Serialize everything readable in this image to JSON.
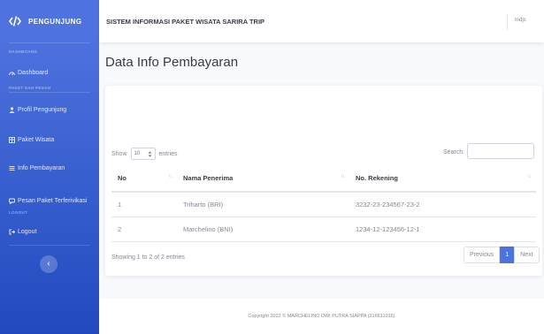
{
  "sidebar": {
    "brand": "PENGUNJUNG",
    "headings": {
      "dashboard": "DASHBOARD",
      "paket": "PAKET DAN PESAN",
      "logout": "LOGOUT"
    },
    "items": [
      {
        "label": "Dashboard",
        "icon": "gauge-icon"
      },
      {
        "label": "Profil Pengunjung",
        "icon": "user-icon"
      },
      {
        "label": "Paket Wisata",
        "icon": "table-icon"
      },
      {
        "label": "Info Pembayaran",
        "icon": "list-icon"
      },
      {
        "label": "Pesan Paket Terferivikasi",
        "icon": "chat-icon"
      },
      {
        "label": "Logout",
        "icon": "logout-icon"
      }
    ],
    "toggle_glyph": "‹"
  },
  "topbar": {
    "title": "SISTEM INFORMASI PAKET WISATA SARIRA TRIP",
    "user": "mdjs"
  },
  "page_title": "Data Info Pembayaran",
  "table_controls": {
    "show": "Show",
    "entries_value": "10",
    "entries": "entries",
    "search_label": "Search:",
    "search_value": ""
  },
  "table": {
    "headers": [
      "No",
      "Nama Penerima",
      "No. Rekening"
    ],
    "rows": [
      [
        "1",
        "Triharto (BRI)",
        "3232-23-234567-23-2"
      ],
      [
        "2",
        "Marchelino (BNI)",
        "1234-12-123456-12-1"
      ]
    ]
  },
  "info_text": "Showing 1 to 2 of 2 entries",
  "pagination": {
    "previous": "Previous",
    "current": "1",
    "next": "Next"
  },
  "footer": "Copyright 2022 © MARCHELINO DWI PUTRA SIAPPA (216611015)",
  "colors": {
    "primary": "#4e73df",
    "primary_dark": "#224abe",
    "background": "#f8f9fc"
  }
}
